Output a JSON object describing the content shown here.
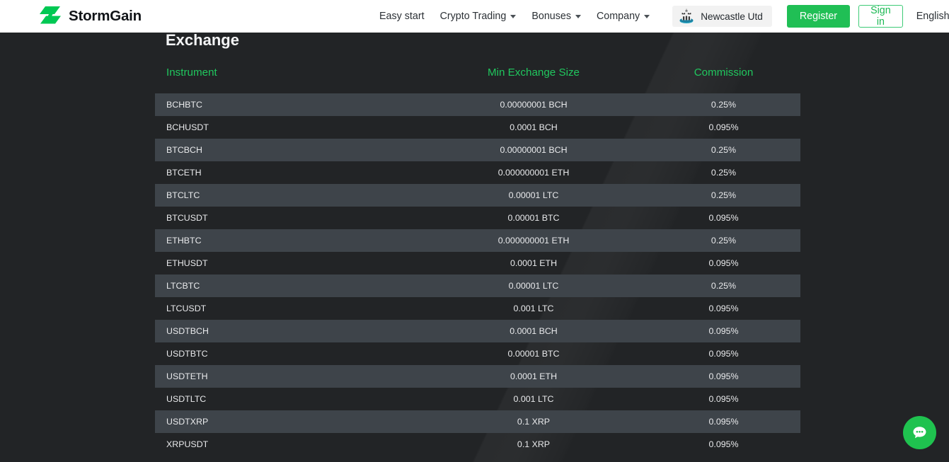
{
  "header": {
    "brand": {
      "name": "StormGain",
      "logo_icon": "stormgain-bolt-logo",
      "color": "#00c853"
    },
    "nav": [
      {
        "label": "Easy start",
        "has_dropdown": false
      },
      {
        "label": "Crypto Trading",
        "has_dropdown": true
      },
      {
        "label": "Bonuses",
        "has_dropdown": true
      },
      {
        "label": "Company",
        "has_dropdown": true
      }
    ],
    "club_badge": {
      "label": "Newcastle Utd",
      "icon": "newcastle-united-crest"
    },
    "register_label": "Register",
    "signin_label": "Sign in",
    "language": {
      "label": "English",
      "icon": "chevron-down-icon"
    }
  },
  "main": {
    "section_title": "Exchange",
    "columns": [
      "Instrument",
      "Min Exchange Size",
      "Commission"
    ],
    "rows": [
      {
        "instrument": "BCHBTC",
        "min_size": "0.00000001 BCH",
        "commission": "0.25%"
      },
      {
        "instrument": "BCHUSDT",
        "min_size": "0.0001 BCH",
        "commission": "0.095%"
      },
      {
        "instrument": "BTCBCH",
        "min_size": "0.00000001 BCH",
        "commission": "0.25%"
      },
      {
        "instrument": "BTCETH",
        "min_size": "0.000000001 ETH",
        "commission": "0.25%"
      },
      {
        "instrument": "BTCLTC",
        "min_size": "0.00001 LTC",
        "commission": "0.25%"
      },
      {
        "instrument": "BTCUSDT",
        "min_size": "0.00001 BTC",
        "commission": "0.095%"
      },
      {
        "instrument": "ETHBTC",
        "min_size": "0.000000001 ETH",
        "commission": "0.25%"
      },
      {
        "instrument": "ETHUSDT",
        "min_size": "0.0001 ETH",
        "commission": "0.095%"
      },
      {
        "instrument": "LTCBTC",
        "min_size": "0.00001 LTC",
        "commission": "0.25%"
      },
      {
        "instrument": "LTCUSDT",
        "min_size": "0.001 LTC",
        "commission": "0.095%"
      },
      {
        "instrument": "USDTBCH",
        "min_size": "0.0001 BCH",
        "commission": "0.095%"
      },
      {
        "instrument": "USDTBTC",
        "min_size": "0.00001 BTC",
        "commission": "0.095%"
      },
      {
        "instrument": "USDTETH",
        "min_size": "0.0001 ETH",
        "commission": "0.095%"
      },
      {
        "instrument": "USDTLTC",
        "min_size": "0.001 LTC",
        "commission": "0.095%"
      },
      {
        "instrument": "USDTXRP",
        "min_size": "0.1 XRP",
        "commission": "0.095%"
      },
      {
        "instrument": "XRPUSDT",
        "min_size": "0.1 XRP",
        "commission": "0.095%"
      }
    ]
  },
  "chat_widget": {
    "icon": "chat-bubble-icon",
    "color": "#1fc24f"
  }
}
